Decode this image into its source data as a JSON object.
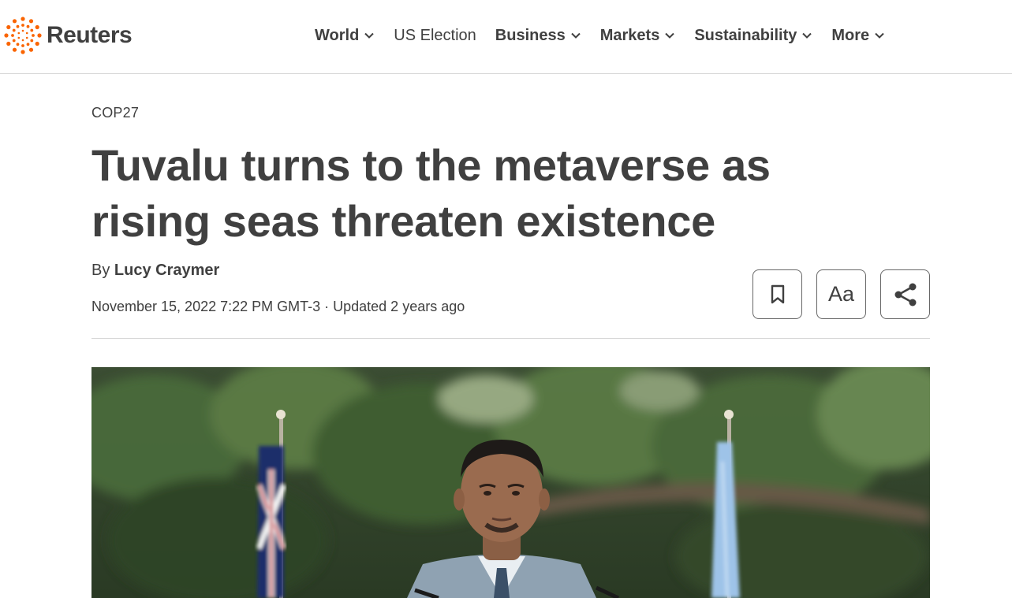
{
  "brand": {
    "name": "Reuters",
    "accent": "#fa6400"
  },
  "nav": {
    "items": [
      {
        "label": "World",
        "dropdown": true
      },
      {
        "label": "US Election",
        "dropdown": false
      },
      {
        "label": "Business",
        "dropdown": true
      },
      {
        "label": "Markets",
        "dropdown": true
      },
      {
        "label": "Sustainability",
        "dropdown": true
      },
      {
        "label": "More",
        "dropdown": true
      }
    ]
  },
  "article": {
    "kicker": "COP27",
    "headline": "Tuvalu turns to the metaverse as rising seas threaten existence",
    "byline_prefix": "By ",
    "author": "Lucy Craymer",
    "dateline": "November 15, 2022 7:22 PM GMT-3 · Updated 2 years ago"
  },
  "tools": {
    "bookmark_icon": "bookmark-icon",
    "text_size_label": "Aa",
    "share_icon": "share-icon"
  },
  "hero": {
    "icon": "photo-speaker-flags",
    "colors": {
      "foliage": "#2f4a2a",
      "flag_blue": "#9ec3e8",
      "flag_red": "#c8102e"
    }
  }
}
